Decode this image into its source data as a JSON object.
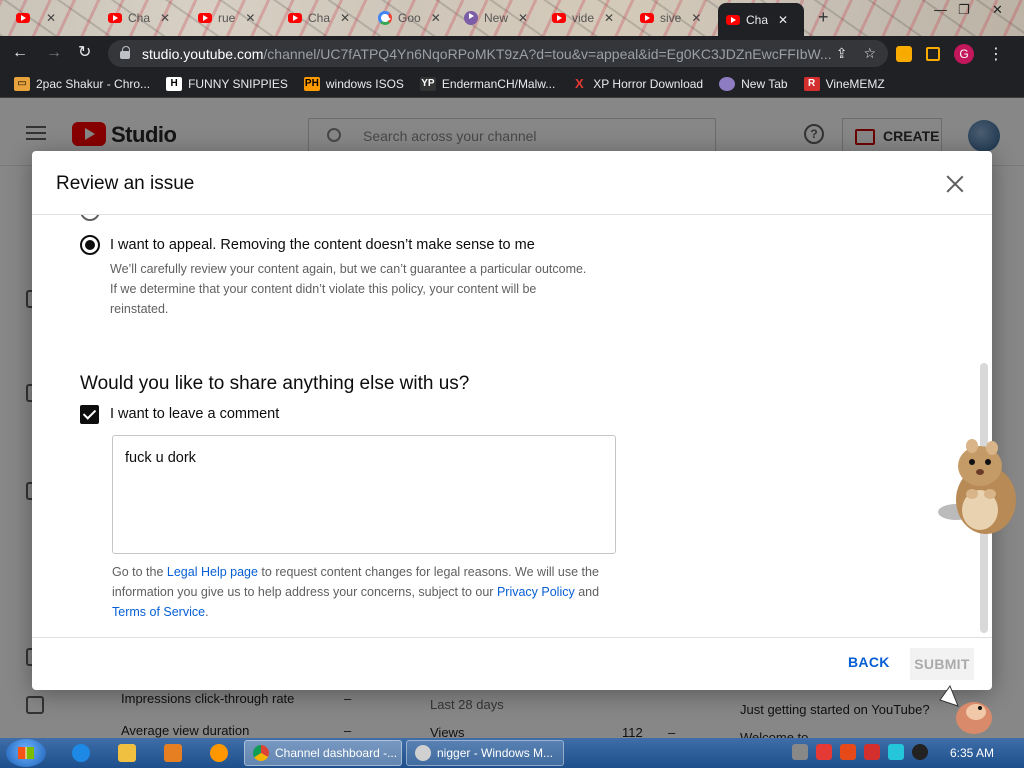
{
  "browser": {
    "tabs": [
      {
        "label": "",
        "icon": "youtube-icon"
      },
      {
        "label": "Cha",
        "icon": "youtube-icon"
      },
      {
        "label": "rue",
        "icon": "youtube-icon"
      },
      {
        "label": "Cha",
        "icon": "youtube-icon"
      },
      {
        "label": "Goo",
        "icon": "google-icon"
      },
      {
        "label": "New",
        "icon": "nexus-icon"
      },
      {
        "label": "vide",
        "icon": "youtube-icon"
      },
      {
        "label": "sive",
        "icon": "youtube-icon"
      },
      {
        "label": "Cha",
        "icon": "youtube-icon",
        "active": true
      }
    ],
    "url_host": "studio.youtube.com",
    "url_path": "/channel/UC7fATPQ4Yn6NqoRPoMKT9zA?d=tou&v=appeal&id=Eg0KC3JDZnEwcFFIbW...",
    "profile_initial": "G",
    "bookmarks": [
      {
        "label": "2pac Shakur - Chro...",
        "icon": "folder-icon"
      },
      {
        "label": "FUNNY SNIPPIES",
        "icon": "h-icon"
      },
      {
        "label": "windows ISOS",
        "icon": "ph-icon"
      },
      {
        "label": "EndermanCH/Malw...",
        "icon": "yp-icon"
      },
      {
        "label": "XP Horror Download",
        "icon": "x-icon"
      },
      {
        "label": "New Tab",
        "icon": "globe-icon"
      },
      {
        "label": "VineMEMZ",
        "icon": "r-icon"
      }
    ]
  },
  "studio": {
    "logo_text": "Studio",
    "search_placeholder": "Search across your channel",
    "create_label": "CREATE",
    "background": {
      "impressions_ctr": "Impressions click-through rate",
      "avg_view_duration": "Average view duration",
      "dash1": "–",
      "dash2": "–",
      "last28": "Last 28 days",
      "views_label": "Views",
      "views_value": "112",
      "dash3": "–",
      "getting_started": "Just getting started on YouTube?",
      "welcome": "Welcome to"
    }
  },
  "modal": {
    "title": "Review an issue",
    "option_appeal_label": "I want to appeal. Removing the content doesn’t make sense to me",
    "option_appeal_desc": "We’ll carefully review your content again, but we can’t guarantee a particular outcome. If we determine that your content didn’t violate this policy, your content will be reinstated.",
    "share_title": "Would you like to share anything else with us?",
    "comment_checkbox_label": "I want to leave a comment",
    "comment_value": "fuck u dork",
    "legal_prefix": "Go to the ",
    "legal_link": "Legal Help page",
    "legal_mid": " to request content changes for legal reasons. We will use the information you give us to help address your concerns, subject to our ",
    "privacy_link": "Privacy Policy",
    "legal_and": " and ",
    "terms_link": "Terms of Service",
    "legal_end": ".",
    "back_label": "BACK",
    "submit_label": "SUBMIT"
  },
  "taskbar": {
    "tasks": [
      {
        "label": "Channel dashboard -...",
        "icon": "chrome-icon",
        "active": true
      },
      {
        "label": "nigger - Windows M...",
        "icon": "movie-maker-icon"
      }
    ],
    "clock": "6:35 AM"
  }
}
